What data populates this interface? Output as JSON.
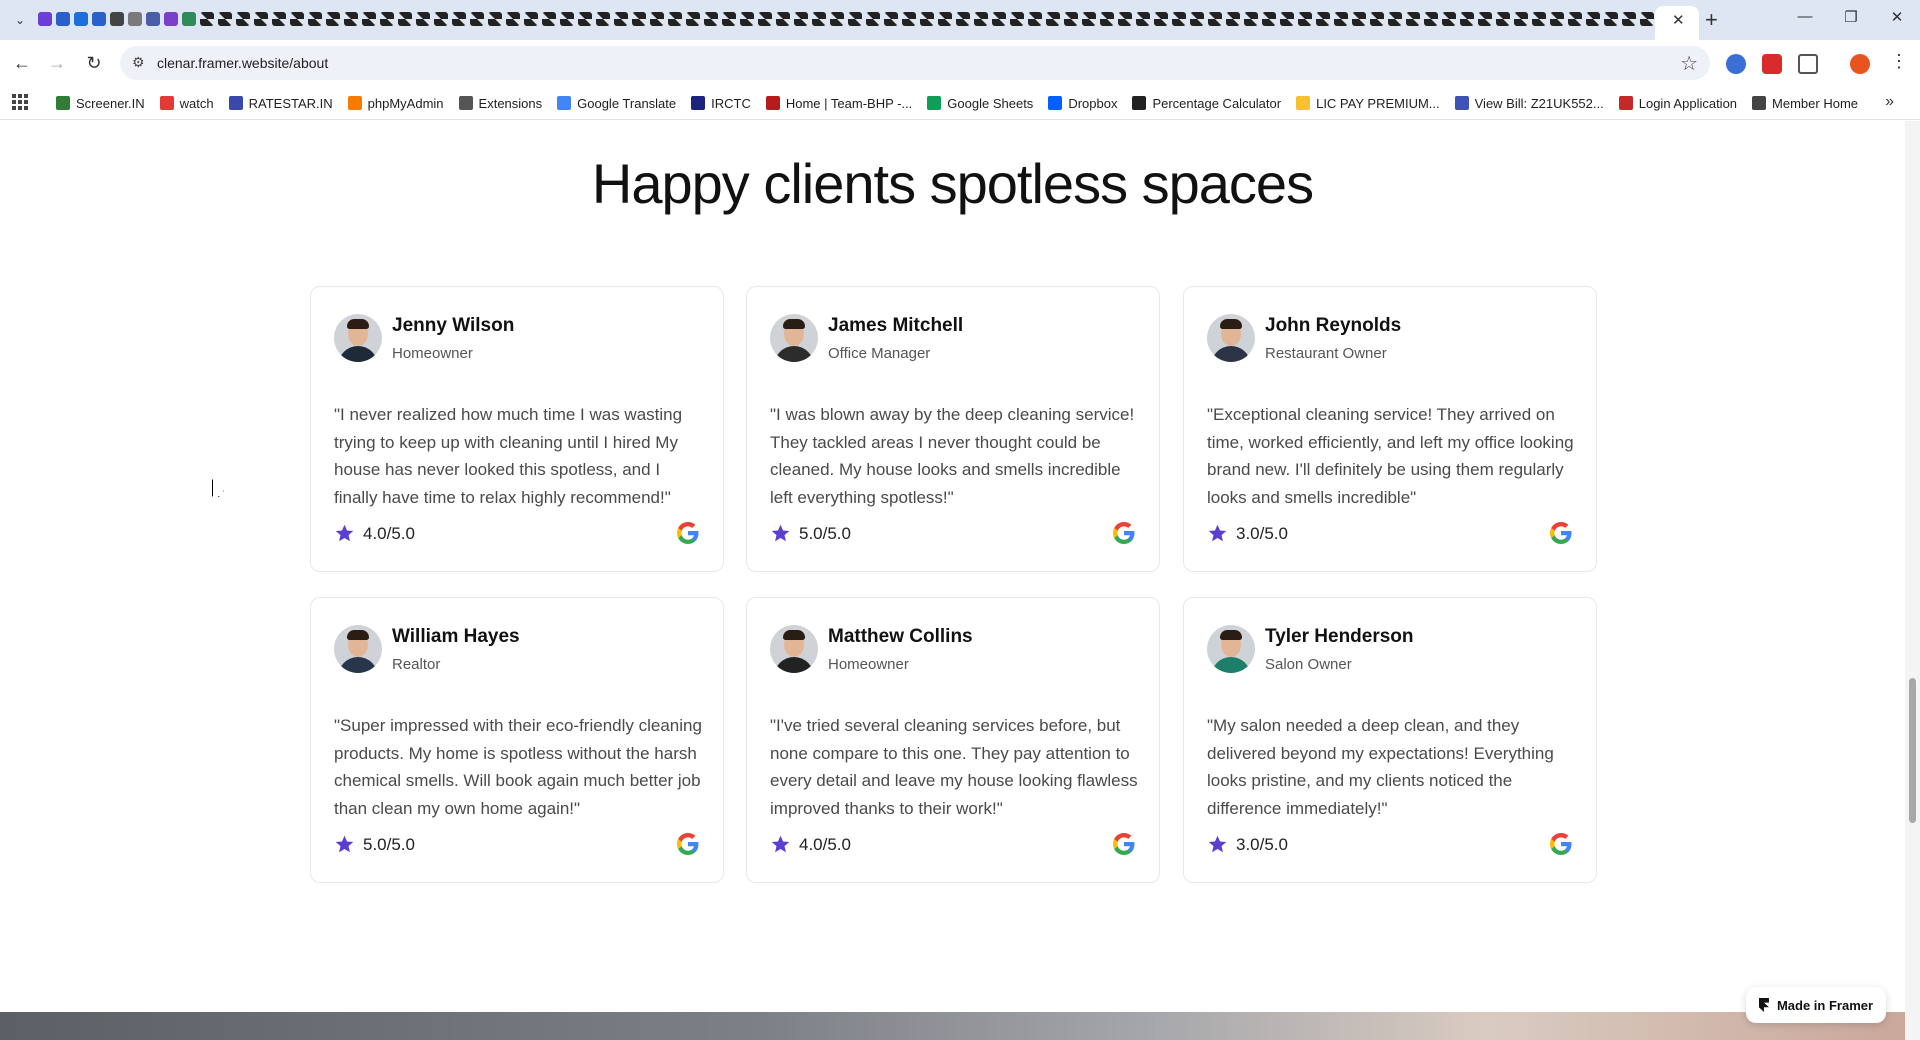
{
  "browser": {
    "url": "clenar.framer.website/about",
    "bookmarks": [
      {
        "label": "Screener.IN",
        "color": "#2e7d32"
      },
      {
        "label": "watch",
        "color": "#e53935"
      },
      {
        "label": "RATESTAR.IN",
        "color": "#3949ab"
      },
      {
        "label": "phpMyAdmin",
        "color": "#f57c00"
      },
      {
        "label": "Extensions",
        "color": "#555555"
      },
      {
        "label": "Google Translate",
        "color": "#4285f4"
      },
      {
        "label": "IRCTC",
        "color": "#1a237e"
      },
      {
        "label": "Home | Team-BHP -...",
        "color": "#b71c1c"
      },
      {
        "label": "Google Sheets",
        "color": "#0f9d58"
      },
      {
        "label": "Dropbox",
        "color": "#0061fe"
      },
      {
        "label": "Percentage Calculator",
        "color": "#222222"
      },
      {
        "label": "LIC PAY PREMIUM...",
        "color": "#fbc02d"
      },
      {
        "label": "View Bill: Z21UK552...",
        "color": "#3f51b5"
      },
      {
        "label": "Login Application",
        "color": "#c62828"
      },
      {
        "label": "Member Home",
        "color": "#444444"
      }
    ]
  },
  "page": {
    "headline": "Happy clients spotless spaces",
    "testimonials": [
      {
        "name": "Jenny Wilson",
        "role": "Homeowner",
        "quote": "\"I never realized how much time I was wasting trying to keep up with cleaning until I hired My house has never looked this spotless, and I finally have time to relax highly recommend!\"",
        "rating": "4.0/5.0"
      },
      {
        "name": "James Mitchell",
        "role": "Office Manager",
        "quote": "\"I was blown away by the deep cleaning service! They tackled areas I never thought could be cleaned. My house looks and smells incredible left everything spotless!\"",
        "rating": "5.0/5.0"
      },
      {
        "name": "John Reynolds",
        "role": "Restaurant Owner",
        "quote": "\"Exceptional cleaning service! They arrived on time, worked efficiently, and left my office looking brand new. I'll definitely be using them regularly looks and smells incredible\"",
        "rating": "3.0/5.0"
      },
      {
        "name": "William Hayes",
        "role": "Realtor",
        "quote": "\"Super impressed with their eco-friendly cleaning products. My home is spotless without the harsh chemical smells. Will book again much better job than clean my own home again!\"",
        "rating": "5.0/5.0"
      },
      {
        "name": "Matthew Collins",
        "role": "Homeowner",
        "quote": "\"I've tried several cleaning services before, but none compare to this one. They pay attention to every detail and leave my house looking flawless improved thanks to their work!\"",
        "rating": "4.0/5.0"
      },
      {
        "name": "Tyler Henderson",
        "role": "Salon Owner",
        "quote": "\"My salon needed a deep clean, and they delivered beyond my expectations! Everything looks pristine, and my clients noticed the difference immediately!\"",
        "rating": "3.0/5.0"
      }
    ],
    "star_color": "#5a3fd0",
    "badge": "Made in Framer"
  }
}
